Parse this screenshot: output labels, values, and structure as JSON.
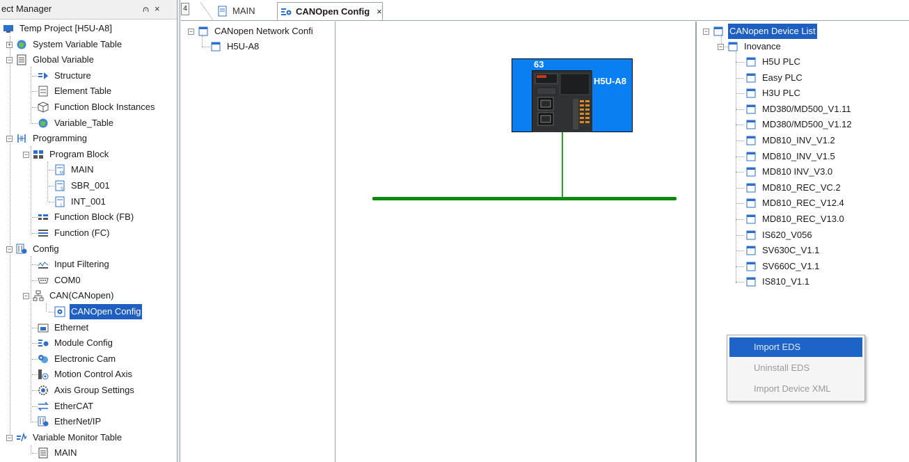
{
  "project_panel": {
    "title": "ect Manager",
    "pin_glyph": "⩀",
    "close_glyph": "×"
  },
  "project_tree": [
    {
      "label": "Temp Project [H5U-A8]",
      "icon": "project-icon"
    },
    {
      "label": "System Variable Table",
      "icon": "globe-icon"
    },
    {
      "label": "Global Variable",
      "icon": "table-icon"
    },
    {
      "label": "Structure",
      "icon": "structure-icon"
    },
    {
      "label": "Element Table",
      "icon": "element-table-icon"
    },
    {
      "label": "Function Block Instances",
      "icon": "cube-icon"
    },
    {
      "label": "Variable_Table",
      "icon": "globe-icon"
    },
    {
      "label": "Programming",
      "icon": "programming-icon"
    },
    {
      "label": "Program Block",
      "icon": "blocks-icon"
    },
    {
      "label": "MAIN",
      "icon": "main-program-icon"
    },
    {
      "label": "SBR_001",
      "icon": "subroutine-icon"
    },
    {
      "label": "INT_001",
      "icon": "interrupt-icon"
    },
    {
      "label": "Function Block (FB)",
      "icon": "function-block-icon"
    },
    {
      "label": "Function (FC)",
      "icon": "function-icon"
    },
    {
      "label": "Config",
      "icon": "config-icon"
    },
    {
      "label": "Input Filtering",
      "icon": "filter-icon"
    },
    {
      "label": "COM0",
      "icon": "serial-port-icon"
    },
    {
      "label": "CAN(CANopen)",
      "icon": "network-icon"
    },
    {
      "label": "CANOpen Config",
      "icon": "canopen-config-icon"
    },
    {
      "label": "Ethernet",
      "icon": "ethernet-icon"
    },
    {
      "label": "Module Config",
      "icon": "module-config-icon"
    },
    {
      "label": "Electronic Cam",
      "icon": "cam-icon"
    },
    {
      "label": "Motion Control Axis",
      "icon": "axis-icon"
    },
    {
      "label": "Axis Group Settings",
      "icon": "gear-icon"
    },
    {
      "label": "EtherCAT",
      "icon": "ethercat-icon"
    },
    {
      "label": "EtherNet/IP",
      "icon": "ethernet-ip-icon"
    },
    {
      "label": "Variable Monitor Table",
      "icon": "monitor-table-icon"
    },
    {
      "label": "MAIN",
      "icon": "table-icon"
    }
  ],
  "tabs": {
    "scroll_glyph": "4",
    "main_label": "MAIN",
    "active_label": "CANOpen Config",
    "close_glyph": "×"
  },
  "network_tree": {
    "root_label": "CANopen Network Confi",
    "child_label": "H5U-A8"
  },
  "canvas": {
    "node_id": "63",
    "device_name": "H5U-A8",
    "device_fill": "#0a7ff2",
    "bus_color": "#0d8a0d"
  },
  "device_list": {
    "root_label": "CANopen Device List",
    "vendor_label": "Inovance",
    "items": [
      "H5U PLC",
      "Easy PLC",
      "H3U PLC",
      "MD380/MD500_V1.11",
      "MD380/MD500_V1.12",
      "MD810_INV_V1.2",
      "MD810_INV_V1.5",
      "MD810 INV_V3.0",
      "MD810_REC_VC.2",
      "MD810_REC_V12.4",
      "MD810_REC_V13.0",
      "IS620_V056",
      "SV630C_V1.1",
      "SV660C_V1.1",
      "IS810_V1.1"
    ]
  },
  "context_menu": {
    "items": [
      "Import EDS",
      "Uninstall EDS",
      "Import Device XML"
    ],
    "highlight_color": "#1e64c8"
  }
}
